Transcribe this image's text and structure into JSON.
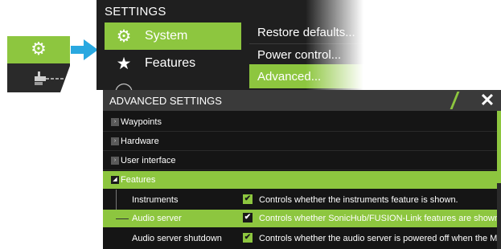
{
  "icons": {
    "tile_gear": "gear-icon",
    "tile_device": "device-icon",
    "arrow": "arrow-right-icon",
    "system": "gear-icon",
    "features": "star-icon",
    "close": "close-icon",
    "expand": "expand-arrow-icon",
    "checkbox": "checkmark-icon"
  },
  "colors": {
    "accent": "#8dc63f",
    "arrow": "#29a8e0",
    "dark": "#1f1f1f"
  },
  "settings": {
    "title": "SETTINGS",
    "categories": [
      {
        "label": "System"
      },
      {
        "label": "Features"
      }
    ],
    "submenu": [
      {
        "label": "Restore defaults..."
      },
      {
        "label": "Power control..."
      },
      {
        "label": "Advanced..."
      }
    ]
  },
  "advanced": {
    "title": "ADVANCED SETTINGS",
    "close_glyph": "✕",
    "groups": [
      {
        "label": "Waypoints",
        "toggle": "›"
      },
      {
        "label": "Hardware",
        "toggle": "›"
      },
      {
        "label": "User interface",
        "toggle": "›"
      },
      {
        "label": "Features",
        "toggle": "◢"
      }
    ],
    "feature_rows": [
      {
        "name": "Instruments",
        "checked": true,
        "check_glyph": "✔",
        "description": "Controls whether the instruments feature is shown."
      },
      {
        "name": "Audio server",
        "checked": true,
        "check_glyph": "✔",
        "description": "Controls whether SonicHub/FUSION-Link features are shown."
      },
      {
        "name": "Audio server shutdown",
        "checked": true,
        "check_glyph": "✔",
        "description": "Controls whether the audio server is powered off when the MFD is shut down."
      }
    ]
  }
}
